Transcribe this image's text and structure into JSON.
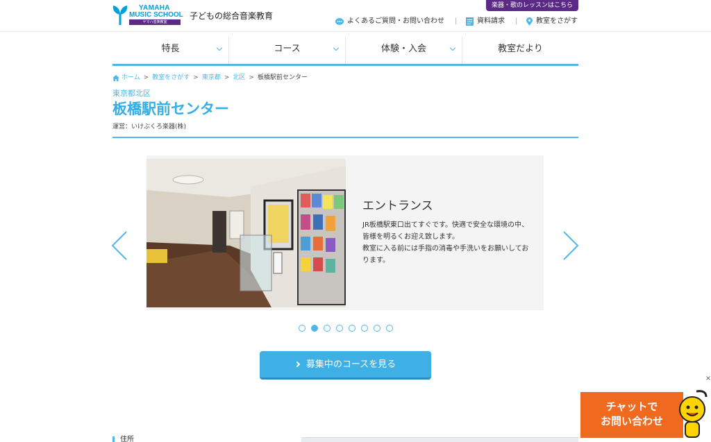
{
  "header": {
    "logo_line1": "YAMAHA",
    "logo_line2": "MUSIC SCHOOL",
    "logo_sub": "ヤマハ音楽教室",
    "tagline": "子どもの総合音楽教育",
    "lesson_button": "楽器・歌のレッスンはこちら",
    "links": [
      {
        "label": "よくあるご質問・お問い合わせ",
        "icon": "chat-bubble-icon"
      },
      {
        "label": "資料請求",
        "icon": "document-icon"
      },
      {
        "label": "教室をさがす",
        "icon": "map-pin-icon"
      }
    ]
  },
  "nav": [
    {
      "label": "特長",
      "has_dropdown": true
    },
    {
      "label": "コース",
      "has_dropdown": true
    },
    {
      "label": "体験・入会",
      "has_dropdown": true
    },
    {
      "label": "教室だより",
      "has_dropdown": false
    }
  ],
  "breadcrumb": [
    "ホーム",
    "教室をさがす",
    "東京都",
    "北区",
    "板橋駅前センター"
  ],
  "area": "東京都北区",
  "title": "板橋駅前センター",
  "operator": "運営：いけぶくろ楽器(株)",
  "slide": {
    "title": "エントランス",
    "text": "JR板橋駅東口出てすぐです。快適で安全な環境の中、皆様を明るくお迎え致します。\n教室に入る前には手指の消毒や手洗いをお願いしております。",
    "current": 2,
    "total": 8
  },
  "cta_label": "募集中のコースを見る",
  "section_label": "住所",
  "chat": {
    "label": "チャットで\nお問い合わせ",
    "close": "×"
  },
  "colors": {
    "accent": "#4db8e8",
    "brand_purple": "#5b2a86",
    "chat_orange": "#ef6a1f"
  }
}
